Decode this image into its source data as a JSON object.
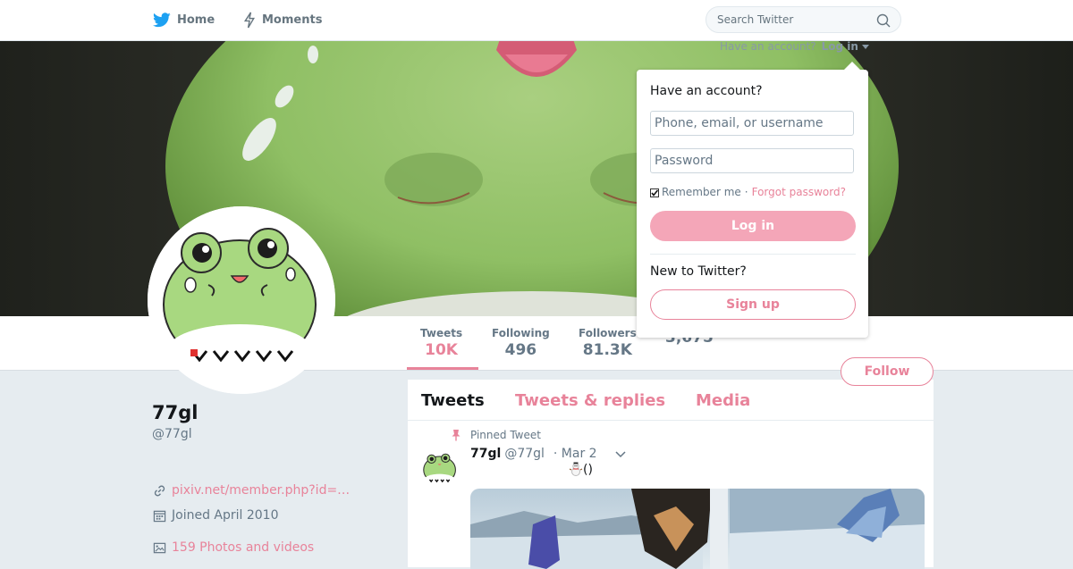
{
  "topbar": {
    "nav": [
      {
        "label": "Home",
        "icon": "bird-icon"
      },
      {
        "label": "Moments",
        "icon": "lightning-icon"
      }
    ],
    "search": {
      "placeholder": "Search Twitter"
    }
  },
  "login_prompt": {
    "text": "Have an account?",
    "link": "Log in"
  },
  "login_popup": {
    "title": "Have an account?",
    "username_placeholder": "Phone, email, or username",
    "password_placeholder": "Password",
    "remember_label": "Remember me",
    "separator": "·",
    "forgot_label": "Forgot password?",
    "login_button": "Log in",
    "new_label": "New to Twitter?",
    "signup_button": "Sign up"
  },
  "stats": [
    {
      "label": "Tweets",
      "value": "10K"
    },
    {
      "label": "Following",
      "value": "496"
    },
    {
      "label": "Followers",
      "value": "81.3K"
    },
    {
      "label": "",
      "value": "3,675"
    }
  ],
  "follow_button": "Follow",
  "profile": {
    "name": "77gl",
    "handle": "@77gl",
    "website": "pixiv.net/member.php?id=…",
    "joined": "Joined April 2010",
    "media": "159 Photos and videos"
  },
  "timeline": {
    "tabs": [
      "Tweets",
      "Tweets & replies",
      "Media"
    ],
    "pinned_label": "Pinned Tweet",
    "tweet": {
      "name": "77gl",
      "handle": "@77gl",
      "date": "· Mar 2",
      "text": "()"
    }
  },
  "colors": {
    "accent": "#e8839a",
    "login_button": "#f4a6b8",
    "twitter_blue": "#1da1f2"
  }
}
